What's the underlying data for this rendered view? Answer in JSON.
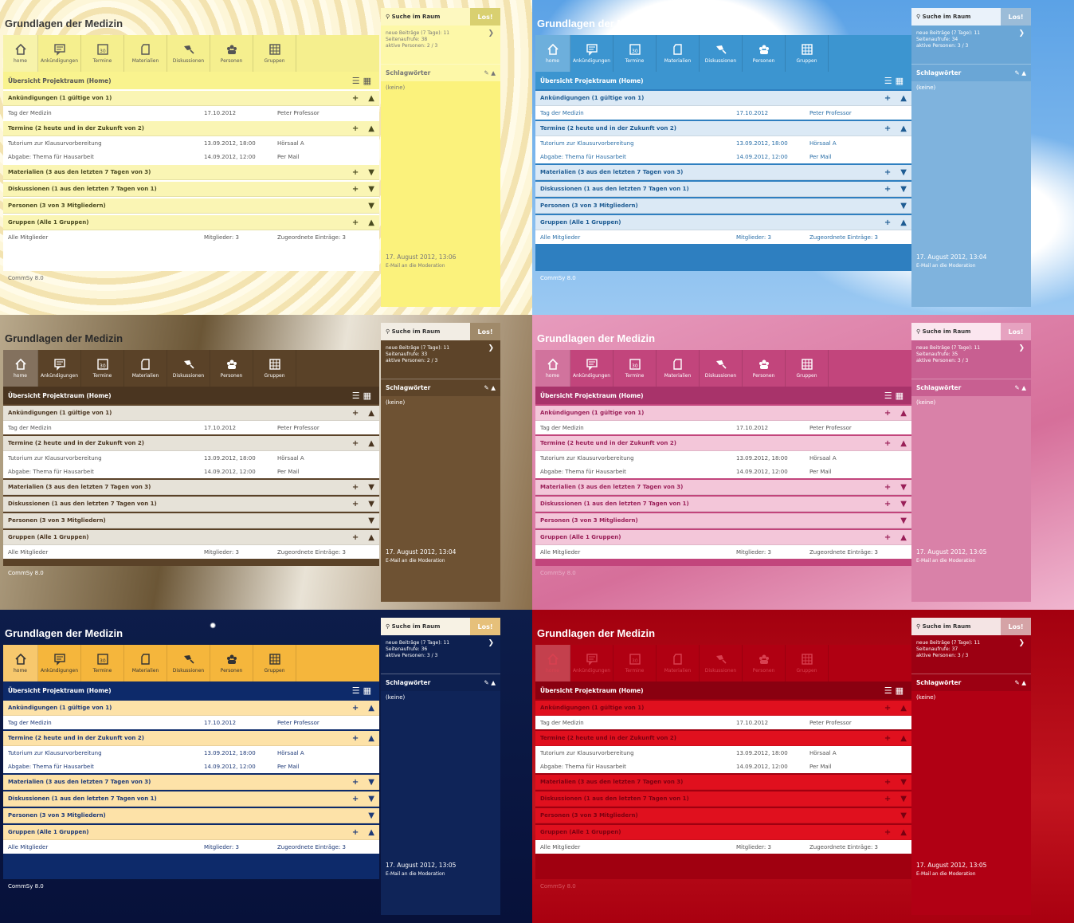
{
  "title": "Grundlagen der Medizin",
  "tabs": [
    {
      "icon": "home-icon",
      "label": "home"
    },
    {
      "icon": "announcement-icon",
      "label": "Ankündigungen"
    },
    {
      "icon": "calendar-icon",
      "label": "Termine"
    },
    {
      "icon": "material-icon",
      "label": "Materialien"
    },
    {
      "icon": "discussion-icon",
      "label": "Diskussionen"
    },
    {
      "icon": "persons-icon",
      "label": "Personen"
    },
    {
      "icon": "groups-icon",
      "label": "Gruppen"
    }
  ],
  "overview_title": "Übersicht Projektraum (Home)",
  "sections": {
    "announcements": "Ankündigungen  (1 gültige von 1)",
    "dates": "Termine  (2 heute und in der Zukunft von 2)",
    "materials": "Materialien  (3 aus den letzten 7 Tagen von 3)",
    "discussions": "Diskussionen  (1 aus den letzten 7 Tagen von 1)",
    "persons": "Personen  (3 von 3 Mitgliedern)",
    "groups": "Gruppen  (Alle 1 Gruppen)"
  },
  "rows": {
    "announcement": [
      "Tag der Medizin",
      "17.10.2012",
      "Peter Professor"
    ],
    "date1": [
      "Tutorium zur Klausurvorbereitung",
      "13.09.2012, 18:00",
      "Hörsaal A"
    ],
    "date2": [
      "Abgabe: Thema für Hausarbeit",
      "14.09.2012, 12:00",
      "Per Mail"
    ],
    "group": [
      "Alle Mitglieder",
      "Mitglieder: 3",
      "Zugeordnete Einträge: 3"
    ]
  },
  "footer": "CommSy 8.0",
  "search": {
    "label": "Suche im Raum",
    "button": "Los!"
  },
  "keywords_title": "Schlagwörter",
  "keywords_empty": "(keine)",
  "mail_link": "E-Mail an die Moderation",
  "themes": [
    {
      "name": "sunflower",
      "stats": [
        "neue Beiträge (7 Tage): 11",
        "Seitenaufrufe: 38",
        "aktive Personen: 2 / 3"
      ],
      "date": "17. August 2012, 13:06"
    },
    {
      "name": "sky",
      "stats": [
        "neue Beiträge (7 Tage): 11",
        "Seitenaufrufe: 34",
        "aktive Personen: 3 / 3"
      ],
      "date": "17. August 2012, 13:04"
    },
    {
      "name": "books",
      "stats": [
        "neue Beiträge (7 Tage): 11",
        "Seitenaufrufe: 33",
        "aktive Personen: 2 / 3"
      ],
      "date": "17. August 2012, 13:04"
    },
    {
      "name": "pink",
      "stats": [
        "neue Beiträge (7 Tage): 11",
        "Seitenaufrufe: 35",
        "aktive Personen: 3 / 3"
      ],
      "date": "17. August 2012, 13:05"
    },
    {
      "name": "stars",
      "stats": [
        "neue Beiträge (7 Tage): 11",
        "Seitenaufrufe: 36",
        "aktive Personen: 3 / 3"
      ],
      "date": "17. August 2012, 13:05"
    },
    {
      "name": "red",
      "stats": [
        "neue Beiträge (7 Tage): 11",
        "Seitenaufrufe: 37",
        "aktive Personen: 3 / 3"
      ],
      "date": "17. August 2012, 13:05"
    }
  ],
  "colors": {
    "sunflower_bar": "#f5ef8e",
    "sky_bar": "#3c95d0",
    "books_bar": "#5a4228",
    "pink_bar": "#c2457c",
    "stars_bar": "#f5b63c",
    "red_bar": "#b00012"
  }
}
